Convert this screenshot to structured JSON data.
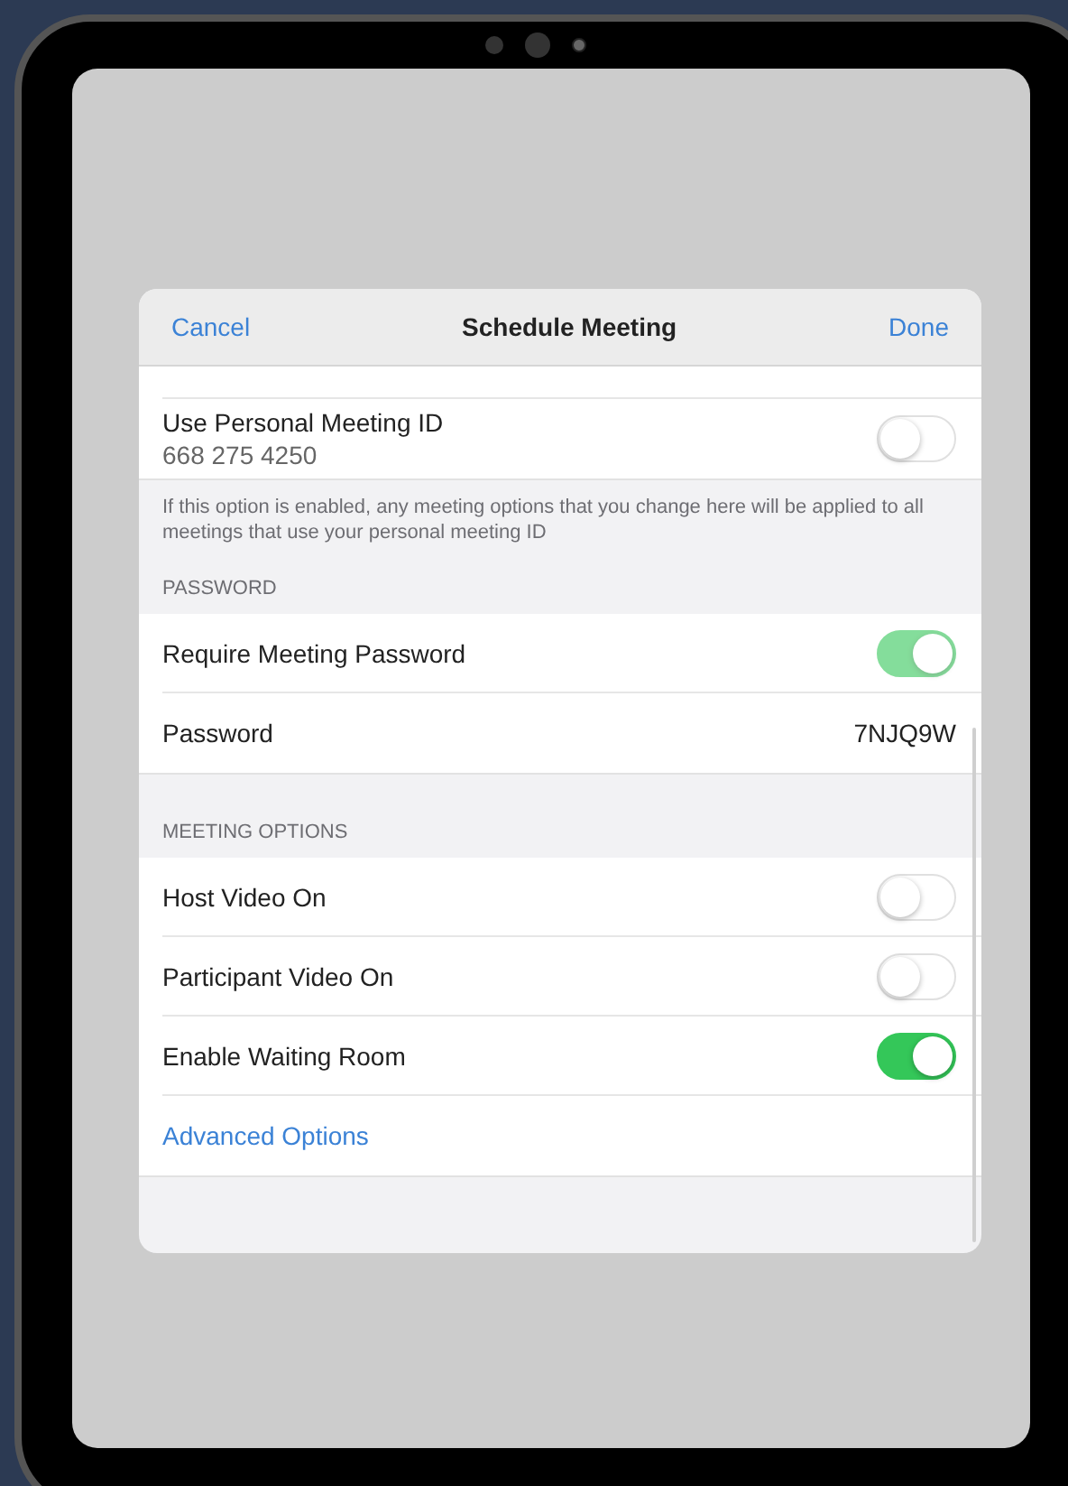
{
  "nav_bar": {
    "cancel": "Cancel",
    "title": "Schedule Meeting",
    "done": "Done"
  },
  "sections": [
    {
      "kind": "rows",
      "rows": [
        {
          "kind": "clipped"
        },
        {
          "kind": "toggle",
          "label": "Use Personal Meeting ID",
          "sublabel": "668 275 4250",
          "on": false,
          "disabled": false
        }
      ]
    },
    {
      "kind": "footer",
      "text": "If this option is enabled, any meeting options that you change here will be applied to all meetings that use your personal meeting ID"
    },
    {
      "kind": "header",
      "text": "PASSWORD"
    },
    {
      "kind": "rows",
      "rows": [
        {
          "kind": "toggle",
          "label": "Require Meeting Password",
          "on": true,
          "disabled": true
        },
        {
          "kind": "value",
          "label": "Password",
          "value": "7NJQ9W"
        }
      ]
    },
    {
      "kind": "header",
      "text": "MEETING OPTIONS"
    },
    {
      "kind": "rows",
      "rows": [
        {
          "kind": "toggle",
          "label": "Host Video On",
          "on": false,
          "disabled": false
        },
        {
          "kind": "toggle",
          "label": "Participant Video On",
          "on": false,
          "disabled": false
        },
        {
          "kind": "toggle",
          "label": "Enable Waiting Room",
          "on": true,
          "disabled": false
        },
        {
          "kind": "link",
          "label": "Advanced Options"
        }
      ]
    }
  ]
}
